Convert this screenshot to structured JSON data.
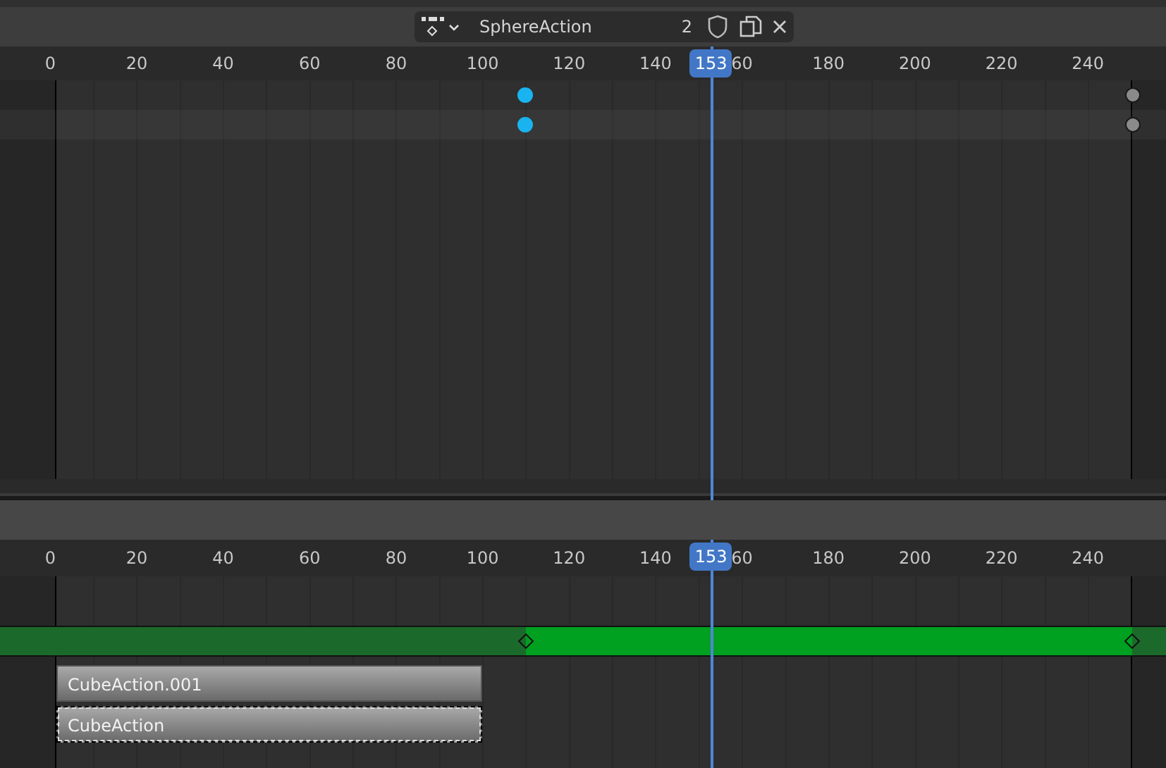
{
  "action_editor": {
    "action_selector": {
      "name": "SphereAction",
      "users": "2"
    },
    "ruler": {
      "ticks": [
        "0",
        "20",
        "40",
        "60",
        "80",
        "100",
        "120",
        "140",
        "60",
        "180",
        "200",
        "220",
        "240"
      ],
      "current_frame": "153"
    },
    "channels": [
      {
        "keyframes": [
          {
            "level": 0.451,
            "selected": true
          },
          {
            "level": 0.971,
            "selected": false
          }
        ]
      },
      {
        "keyframes": [
          {
            "level": 0.451,
            "selected": true
          },
          {
            "level": 0.971,
            "selected": false
          }
        ]
      }
    ]
  },
  "nla_editor": {
    "ruler": {
      "ticks": [
        "0",
        "20",
        "40",
        "60",
        "80",
        "100",
        "120",
        "140",
        "60",
        "180",
        "200",
        "220",
        "240"
      ],
      "current_frame": "153"
    },
    "track": {
      "keyframes": [
        {
          "level": 0.451
        },
        {
          "level": 0.971
        }
      ]
    },
    "strips": [
      {
        "name": "CubeAction.001",
        "selected": false
      },
      {
        "name": "CubeAction",
        "selected": true
      }
    ]
  }
}
